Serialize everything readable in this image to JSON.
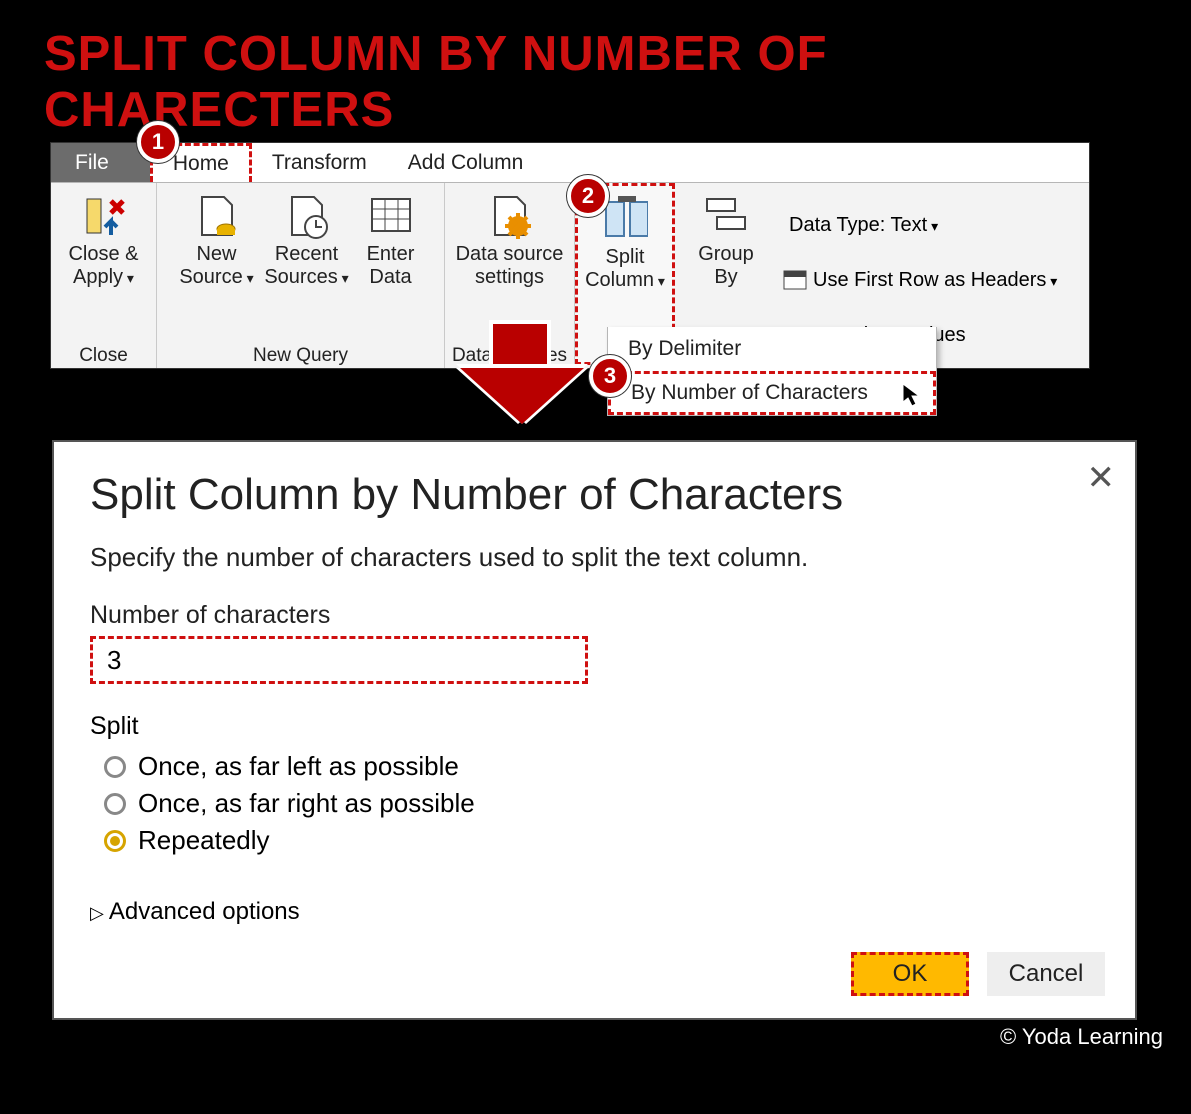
{
  "title": "SPLIT COLUMN BY NUMBER OF CHARECTERS",
  "tabs": {
    "file": "File",
    "home": "Home",
    "transform": "Transform",
    "addcol": "Add Column"
  },
  "ribbon": {
    "close_apply": "Close & Apply",
    "new_source": "New Source",
    "recent_sources": "Recent Sources",
    "enter_data": "Enter Data",
    "data_source_settings": "Data source settings",
    "split_column": "Split Column",
    "group_by": "Group By",
    "data_type": "Data Type: Text",
    "first_row": "Use First Row as Headers",
    "replace_values": "Replace Values",
    "group_close": "Close",
    "group_newquery": "New Query",
    "group_datasources": "Data Sources"
  },
  "dropdown": {
    "by_delimiter": "By Delimiter",
    "by_num_chars": "By Number of Characters"
  },
  "badges": {
    "b1": "1",
    "b2": "2",
    "b3": "3"
  },
  "dialog": {
    "title": "Split Column by Number of Characters",
    "subtitle": "Specify the number of characters used to split the text column.",
    "num_label": "Number of characters",
    "num_value": "3",
    "split_label": "Split",
    "opt_left": "Once, as far left as possible",
    "opt_right": "Once, as far right as possible",
    "opt_repeat": "Repeatedly",
    "advanced": "Advanced options",
    "ok": "OK",
    "cancel": "Cancel"
  },
  "attribution": "© Yoda Learning"
}
